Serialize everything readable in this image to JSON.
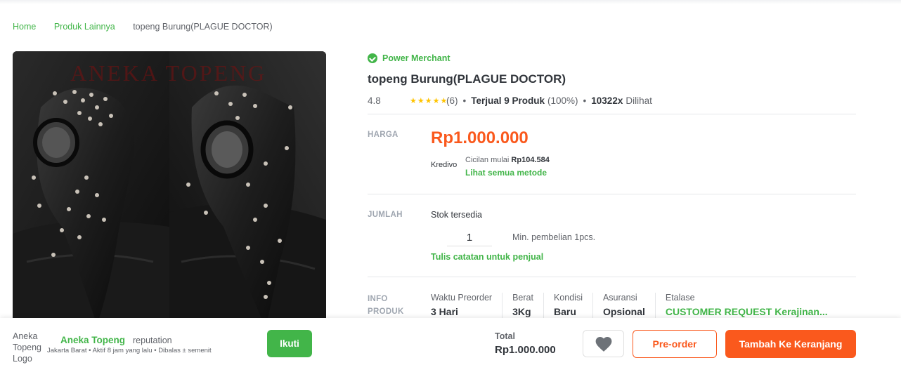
{
  "breadcrumb": {
    "home": "Home",
    "category": "Produk Lainnya",
    "current": "topeng Burung(PLAGUE DOCTOR)"
  },
  "image": {
    "watermark": "ANEKA TOPENG"
  },
  "product": {
    "badge": "Power Merchant",
    "title": "topeng Burung(PLAGUE DOCTOR)",
    "rating": "4.8",
    "rating_stars": 5,
    "review_count": "(6)",
    "sold_label": "Terjual 9 Produk",
    "sold_pct": "(100%)",
    "views_count": "10322x",
    "views_label": "Dilihat"
  },
  "price": {
    "label": "HARGA",
    "value": "Rp1.000.000",
    "installment_provider": "Kredivo",
    "installment_prefix": "Cicilan mulai",
    "installment_value": "Rp104.584",
    "methods_link": "Lihat semua metode"
  },
  "quantity": {
    "label": "JUMLAH",
    "stock_label": "Stok tersedia",
    "value": "1",
    "min_purchase": "Min. pembelian 1pcs.",
    "note_link": "Tulis catatan untuk penjual"
  },
  "info": {
    "label_line1": "INFO",
    "label_line2": "PRODUK",
    "columns": [
      {
        "key": "Waktu Preorder",
        "value": "3 Hari"
      },
      {
        "key": "Berat",
        "value": "3Kg"
      },
      {
        "key": "Kondisi",
        "value": "Baru"
      },
      {
        "key": "Asuransi",
        "value": "Opsional"
      },
      {
        "key": "Etalase",
        "value": "CUSTOMER REQUEST Kerajinan..."
      }
    ]
  },
  "shop": {
    "logo_alt": "Aneka Topeng Logo",
    "name": "Aneka Topeng",
    "reputation": "reputation",
    "meta": "Jakarta Barat • Aktif 8 jam yang lalu • Dibalas ± semenit",
    "follow_label": "Ikuti"
  },
  "checkout": {
    "total_label": "Total",
    "total_value": "Rp1.000.000",
    "preorder_label": "Pre-order",
    "cart_label": "Tambah Ke Keranjang"
  },
  "colors": {
    "accent_green": "#42b549",
    "accent_orange": "#fa591d"
  }
}
